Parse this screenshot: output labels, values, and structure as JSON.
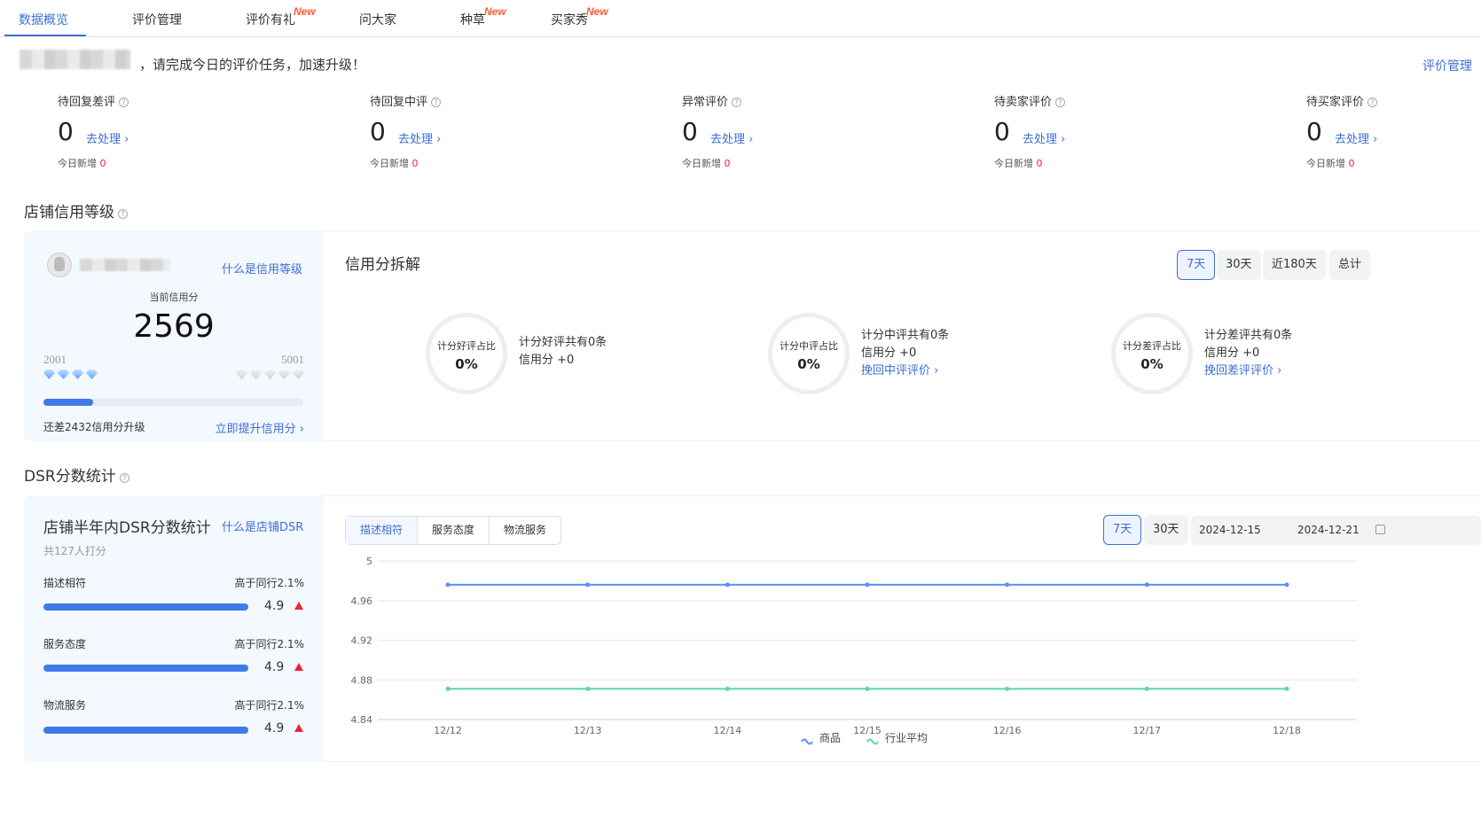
{
  "tabs": [
    {
      "label": "数据概览",
      "badge": ""
    },
    {
      "label": "评价管理",
      "badge": ""
    },
    {
      "label": "评价有礼",
      "badge": "New"
    },
    {
      "label": "问大家",
      "badge": ""
    },
    {
      "label": "种草",
      "badge": "New"
    },
    {
      "label": "买家秀",
      "badge": "New"
    }
  ],
  "notice": {
    "text": "，请完成今日的评价任务，加速升级！",
    "link": "评价管理"
  },
  "stats": [
    {
      "label": "待回复差评",
      "value": "0",
      "action": "去处理",
      "today_label": "今日新增",
      "today_value": "0"
    },
    {
      "label": "待回复中评",
      "value": "0",
      "action": "去处理",
      "today_label": "今日新增",
      "today_value": "0"
    },
    {
      "label": "异常评价",
      "value": "0",
      "action": "去处理",
      "today_label": "今日新增",
      "today_value": "0"
    },
    {
      "label": "待卖家评价",
      "value": "0",
      "action": "去处理",
      "today_label": "今日新增",
      "today_value": "0"
    },
    {
      "label": "待买家评价",
      "value": "0",
      "action": "去处理",
      "today_label": "今日新增",
      "today_value": "0"
    }
  ],
  "credit": {
    "section_title": "店铺信用等级",
    "what_link": "什么是信用等级",
    "current_label": "当前信用分",
    "score": "2569",
    "low": "2001",
    "high": "5001",
    "low_diamonds": 4,
    "high_diamonds": 5,
    "progress_fraction": 0.19,
    "remaining_text": "还差2432信用分升级",
    "improve_link": "立即提升信用分",
    "breakdown_title": "信用分拆解",
    "periods": [
      "7天",
      "30天",
      "近180天",
      "总计"
    ],
    "rings": [
      {
        "label": "计分好评占比",
        "value": "0%",
        "line1": "计分好评共有0条",
        "line2": "信用分 +0",
        "link": ""
      },
      {
        "label": "计分中评占比",
        "value": "0%",
        "line1": "计分中评共有0条",
        "line2": "信用分 +0",
        "link": "挽回中评评价"
      },
      {
        "label": "计分差评占比",
        "value": "0%",
        "line1": "计分差评共有0条",
        "line2": "信用分 +0",
        "link": "挽回差评评价"
      }
    ]
  },
  "dsr": {
    "section_title": "DSR分数统计",
    "panel_title": "店铺半年内DSR分数统计",
    "what_link": "什么是店铺DSR",
    "raters": "共127人打分",
    "rows": [
      {
        "label": "描述相符",
        "compare": "高于同行2.1%",
        "score": "4.9"
      },
      {
        "label": "服务态度",
        "compare": "高于同行2.1%",
        "score": "4.9"
      },
      {
        "label": "物流服务",
        "compare": "高于同行2.1%",
        "score": "4.9"
      }
    ],
    "segments": [
      "描述相符",
      "服务态度",
      "物流服务"
    ],
    "periods": [
      "7天",
      "30天"
    ],
    "date_start": "2024-12-15",
    "date_end": "2024-12-21",
    "colors": {
      "goods": "#5b8ff9",
      "industry": "#5ad8a6"
    }
  },
  "chart_data": {
    "type": "line",
    "x": [
      "12/12",
      "12/13",
      "12/14",
      "12/15",
      "12/16",
      "12/17",
      "12/18"
    ],
    "ylim": [
      4.84,
      5
    ],
    "yticks": [
      "5",
      "4.96",
      "4.92",
      "4.88",
      "4.84"
    ],
    "series": [
      {
        "name": "商品",
        "values": [
          4.976,
          4.976,
          4.976,
          4.976,
          4.976,
          4.976,
          4.976
        ]
      },
      {
        "name": "行业平均",
        "values": [
          4.871,
          4.871,
          4.871,
          4.871,
          4.871,
          4.871,
          4.871
        ]
      }
    ],
    "legend": "bottom-center"
  }
}
